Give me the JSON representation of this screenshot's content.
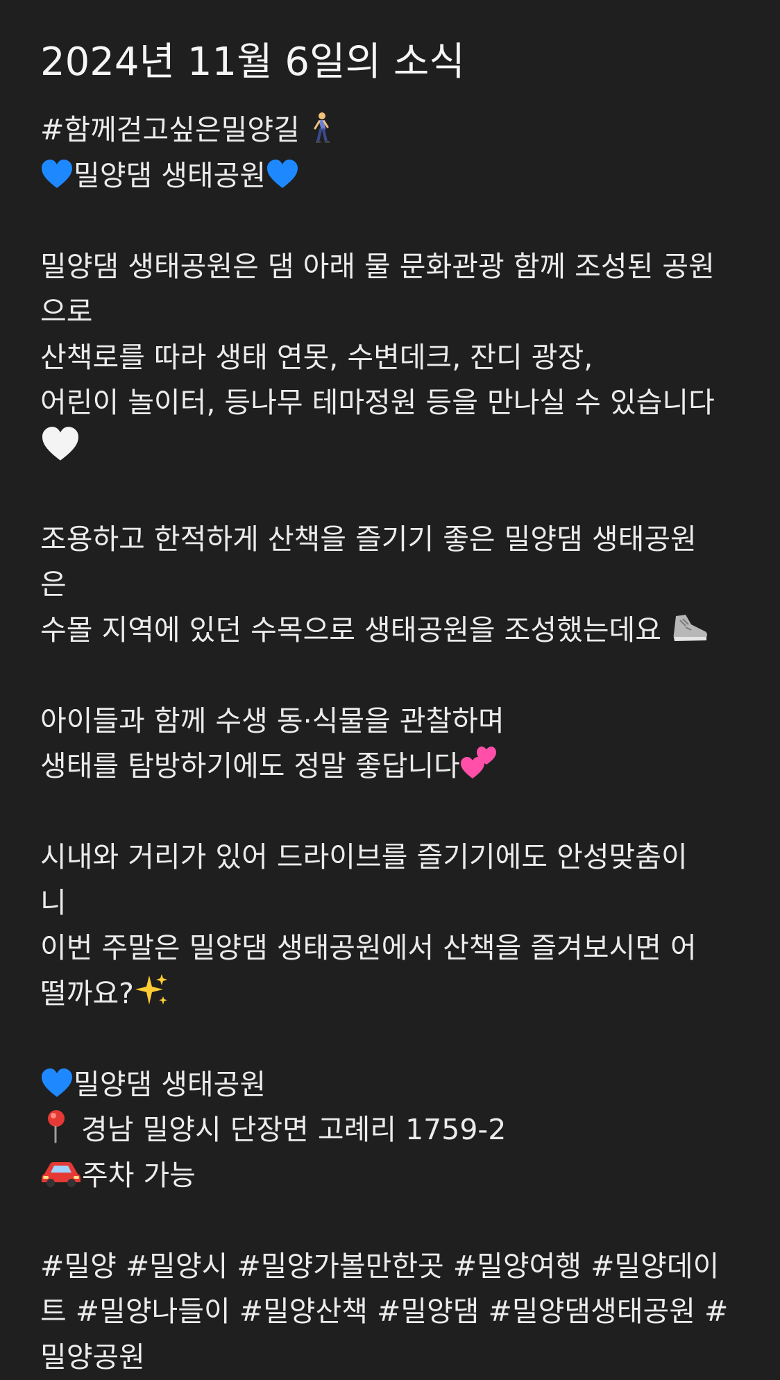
{
  "post": {
    "title": "2024년 11월 6일의 소식",
    "lines": {
      "l1": "#함께걷고싶은밀양길 ",
      "l2": "밀양댐 생태공원",
      "p1_1": "밀양댐 생태공원은 댐 아래 물 문화관광 함께 조성된 공원",
      "p1_2": "으로",
      "p1_3": "산책로를 따라 생태 연못, 수변데크, 잔디 광장,",
      "p1_4": "어린이 놀이터, 등나무 테마정원 등을 만나실 수 있습니다",
      "p2_1": "조용하고 한적하게 산책을 즐기기 좋은 밀양댐 생태공원",
      "p2_2": "은",
      "p2_3": "수몰 지역에 있던 수목으로 생태공원을 조성했는데요 ",
      "p3_1": "아이들과 함께 수생 동·식물을 관찰하며",
      "p3_2": "생태를 탐방하기에도 정말 좋답니다",
      "p4_1": "시내와 거리가 있어 드라이브를 즐기기에도 안성맞춤이",
      "p4_2": "니",
      "p4_3": "이번 주말은 밀양댐 생태공원에서 산책을 즐겨보시면 어",
      "p4_4": "떨까요?",
      "info_1": "밀양댐 생태공원",
      "info_2": " 경남 밀양시 단장면 고례리 1759-2",
      "info_3": "주차 가능",
      "tags_1": "#밀양 #밀양시 #밀양가볼만한곳 #밀양여행 #밀양데이",
      "tags_2": "트 #밀양나들이 #밀양산책 #밀양댐 #밀양댐생태공원 #",
      "tags_3": "밀양공원"
    }
  },
  "icons": {
    "walking": "person-walking-icon",
    "blue_heart": "blue-heart-icon",
    "white_heart": "white-heart-icon",
    "sneaker": "sneaker-icon",
    "two_hearts": "two-hearts-icon",
    "sparkles": "sparkles-icon",
    "pin": "round-pushpin-icon",
    "car": "car-icon"
  },
  "colors": {
    "background": "#1f1f1f",
    "text": "#ececec",
    "blue_heart": "#1e88ff",
    "pink_hearts": "#ff4fa8",
    "sparkles": "#ffcc33",
    "pin": "#e53935",
    "car": "#e53935"
  }
}
